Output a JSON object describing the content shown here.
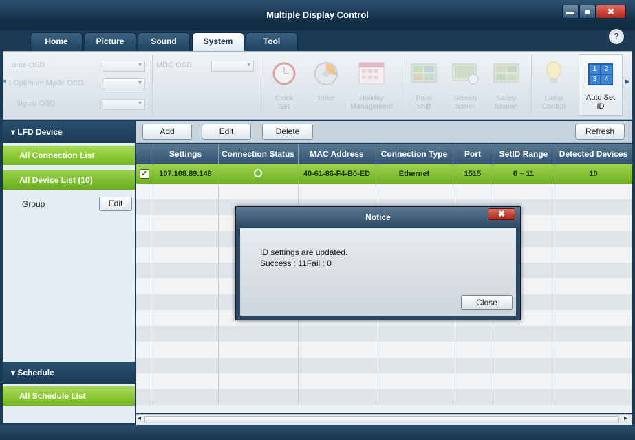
{
  "window": {
    "title": "Multiple Display Control",
    "min_label": "▬",
    "max_label": "■",
    "close_label": "✖",
    "help_label": "?"
  },
  "tabs": [
    {
      "label": "Home"
    },
    {
      "label": "Picture"
    },
    {
      "label": "Sound"
    },
    {
      "label": "System",
      "active": true
    },
    {
      "label": "Tool"
    }
  ],
  "ribbon": {
    "left_labels": [
      "urce OSD",
      "t Optimum Mode OSD",
      "Signal OSD"
    ],
    "left_arrow": "◂",
    "mid_label": "MDC OSD",
    "buttons": [
      {
        "label_line1": "Clock",
        "label_line2": "Set"
      },
      {
        "label_line1": "Timer",
        "label_line2": ""
      },
      {
        "label_line1": "Holiday",
        "label_line2": "Management"
      },
      {
        "label_line1": "Pixel",
        "label_line2": "Shift"
      },
      {
        "label_line1": "Screen",
        "label_line2": "Saver"
      },
      {
        "label_line1": "Safety",
        "label_line2": "Screen"
      },
      {
        "label_line1": "Lamp",
        "label_line2": "Control"
      },
      {
        "label_line1": "Auto Set",
        "label_line2": "ID"
      }
    ],
    "autoset_numbers": [
      "1",
      "2",
      "3",
      "4"
    ],
    "right_arrow": "▸"
  },
  "left_pane": {
    "lfd_header": "▾  LFD Device",
    "all_connection_list": "All Connection List",
    "all_device_list": "All Device List (10)",
    "group_label": "Group",
    "group_edit": "Edit",
    "schedule_header": "▾  Schedule",
    "all_schedule_list": "All Schedule List"
  },
  "toolbar": {
    "add": "Add",
    "edit": "Edit",
    "delete": "Delete",
    "refresh": "Refresh"
  },
  "table": {
    "columns": [
      "Settings",
      "Connection Status",
      "MAC Address",
      "Connection Type",
      "Port",
      "SetID Range",
      "Detected Devices"
    ],
    "rows": [
      {
        "checked": "✓",
        "settings": "107.108.89.148",
        "mac": "40-61-86-F4-B0-ED",
        "type": "Ethernet",
        "port": "1515",
        "setid": "0 ~ 11",
        "detected": "10"
      }
    ]
  },
  "scroll": {
    "left": "◂",
    "right": "▸"
  },
  "dialog": {
    "title": "Notice",
    "close_x": "✖",
    "line1": "ID settings are updated.",
    "line2": "Success : 11Fail :  0",
    "close_button": "Close"
  },
  "colors": {
    "accent_green": "#7cc23c",
    "title_blue": "#1b3a56"
  }
}
